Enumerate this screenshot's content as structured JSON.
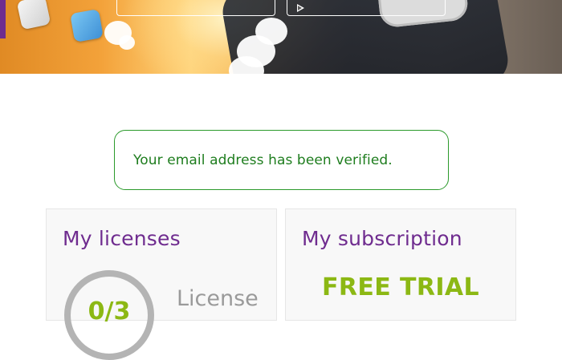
{
  "alert": {
    "message": "Your email address has been verified."
  },
  "licenses_card": {
    "title": "My licenses",
    "used_count": "0/3",
    "label": "License"
  },
  "subscription_card": {
    "title": "My subscription",
    "plan": "FREE TRIAL"
  },
  "colors": {
    "brand_purple": "#6f2c8f",
    "success_green": "#2b9a2b",
    "accent_green": "#8cb814",
    "muted_gray": "#9a9a9a"
  },
  "icons": [
    "play-icon"
  ]
}
